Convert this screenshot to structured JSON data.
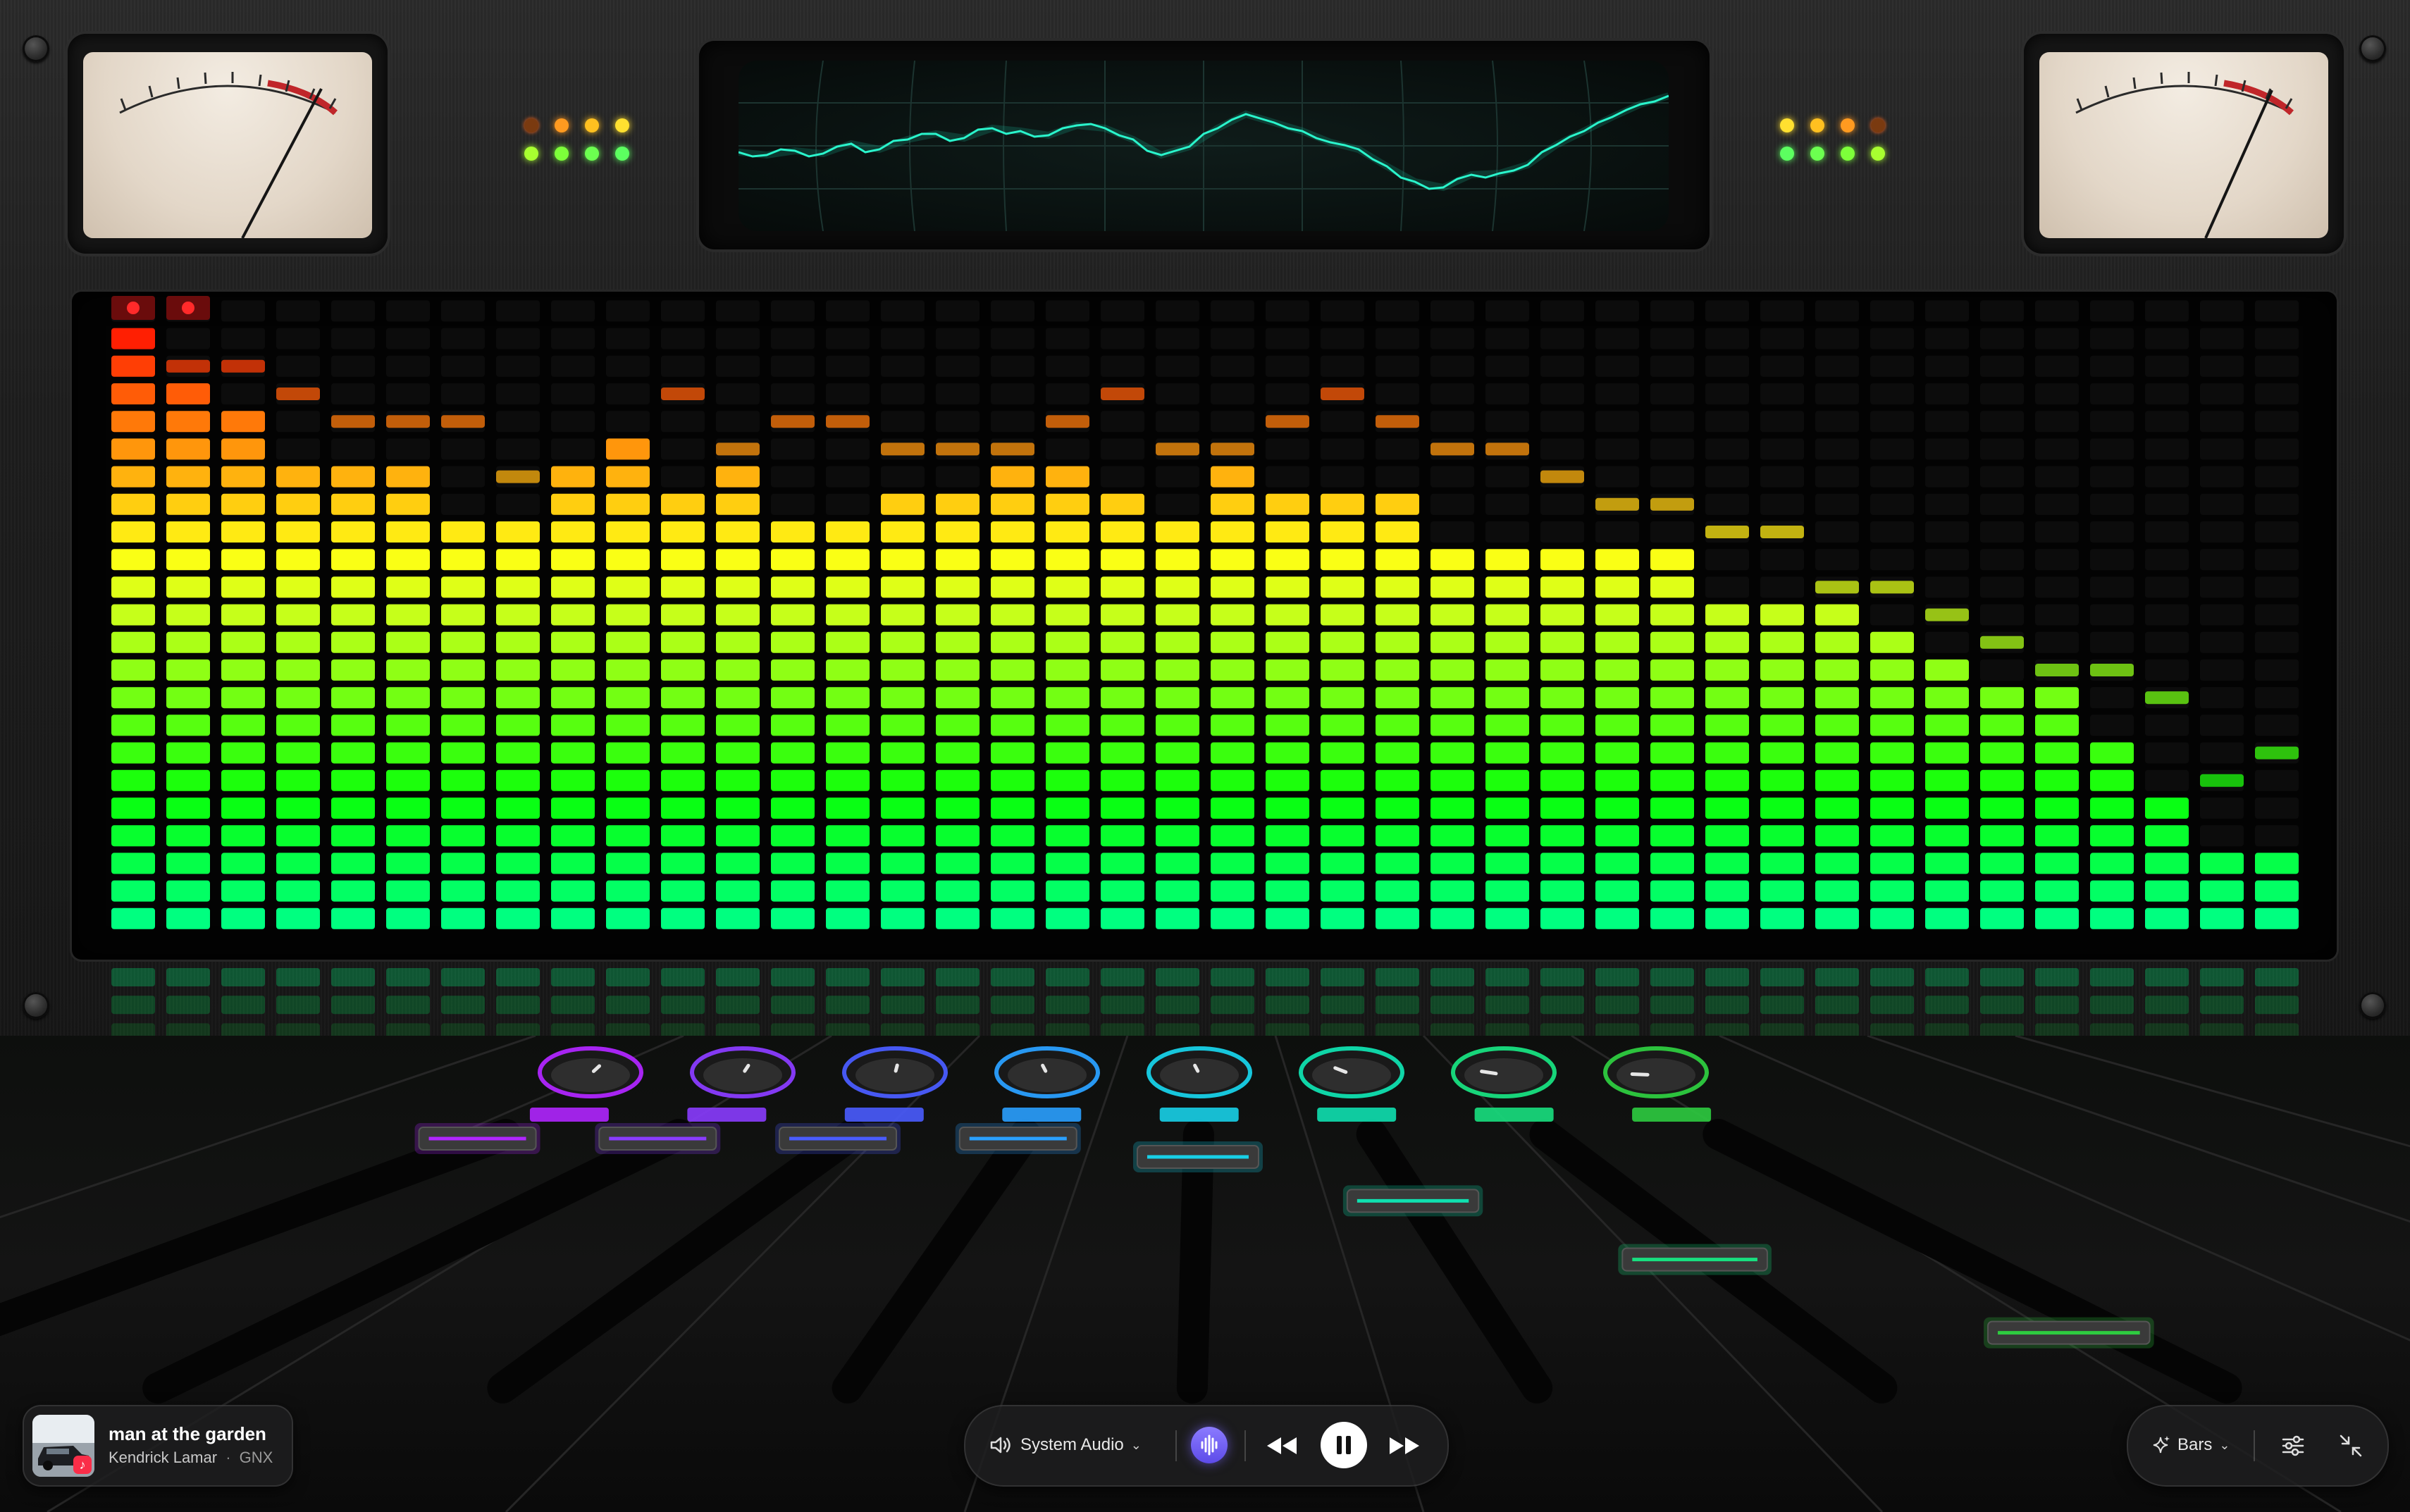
{
  "visualizer": {
    "style": "equalizer-bars",
    "levels": [
      22,
      20,
      19,
      17,
      17,
      17,
      15,
      15,
      17,
      18,
      16,
      17,
      15,
      15,
      16,
      16,
      17,
      17,
      16,
      15,
      17,
      16,
      16,
      16,
      14,
      14,
      14,
      14,
      14,
      12,
      12,
      12,
      11,
      10,
      9,
      9,
      7,
      5,
      3,
      3
    ],
    "peaks": [
      18,
      21,
      21,
      20,
      19,
      19,
      19,
      17,
      17,
      18,
      20,
      18,
      19,
      19,
      18,
      18,
      18,
      19,
      20,
      18,
      18,
      19,
      20,
      19,
      18,
      18,
      17,
      16,
      16,
      15,
      15,
      13,
      13,
      12,
      11,
      10,
      10,
      9,
      6,
      7
    ],
    "total_segments": 23,
    "clip_indicators": [
      true,
      true
    ]
  },
  "mixer": {
    "channels": [
      {
        "color": "#b026ff",
        "knob": 0.8,
        "fader": 0.95
      },
      {
        "color": "#8a3cff",
        "knob": 0.75,
        "fader": 0.95
      },
      {
        "color": "#4a5cff",
        "knob": 0.7,
        "fader": 0.95
      },
      {
        "color": "#2aa0ff",
        "knob": 0.6,
        "fader": 0.95
      },
      {
        "color": "#18d0e8",
        "knob": 0.6,
        "fader": 0.9
      },
      {
        "color": "#10e0b0",
        "knob": 0.4,
        "fader": 0.78
      },
      {
        "color": "#18e080",
        "knob": 0.25,
        "fader": 0.62
      },
      {
        "color": "#2ecc40",
        "knob": 0.15,
        "fader": 0.42
      }
    ]
  },
  "now_playing": {
    "title": "man at the garden",
    "artist": "Kendrick Lamar",
    "separator": "·",
    "album": "GNX",
    "icons": {
      "album_art": "album-art-car",
      "badge": "music-badge-icon"
    }
  },
  "transport": {
    "source_label": "System Audio",
    "source_icon": "speaker-icon",
    "wave_icon": "waveform-icon",
    "state": "playing",
    "accent": "#6e5cf5"
  },
  "view": {
    "style_label": "Bars",
    "style_icon": "sparkle-icon",
    "settings_icon": "sliders-icon",
    "collapse_icon": "collapse-icon"
  },
  "colors": {
    "led_green": "#7dff3a",
    "led_amber": "#ffb020",
    "meter_needle": "#1a1a1a",
    "meter_red_zone": "#c0262a"
  }
}
